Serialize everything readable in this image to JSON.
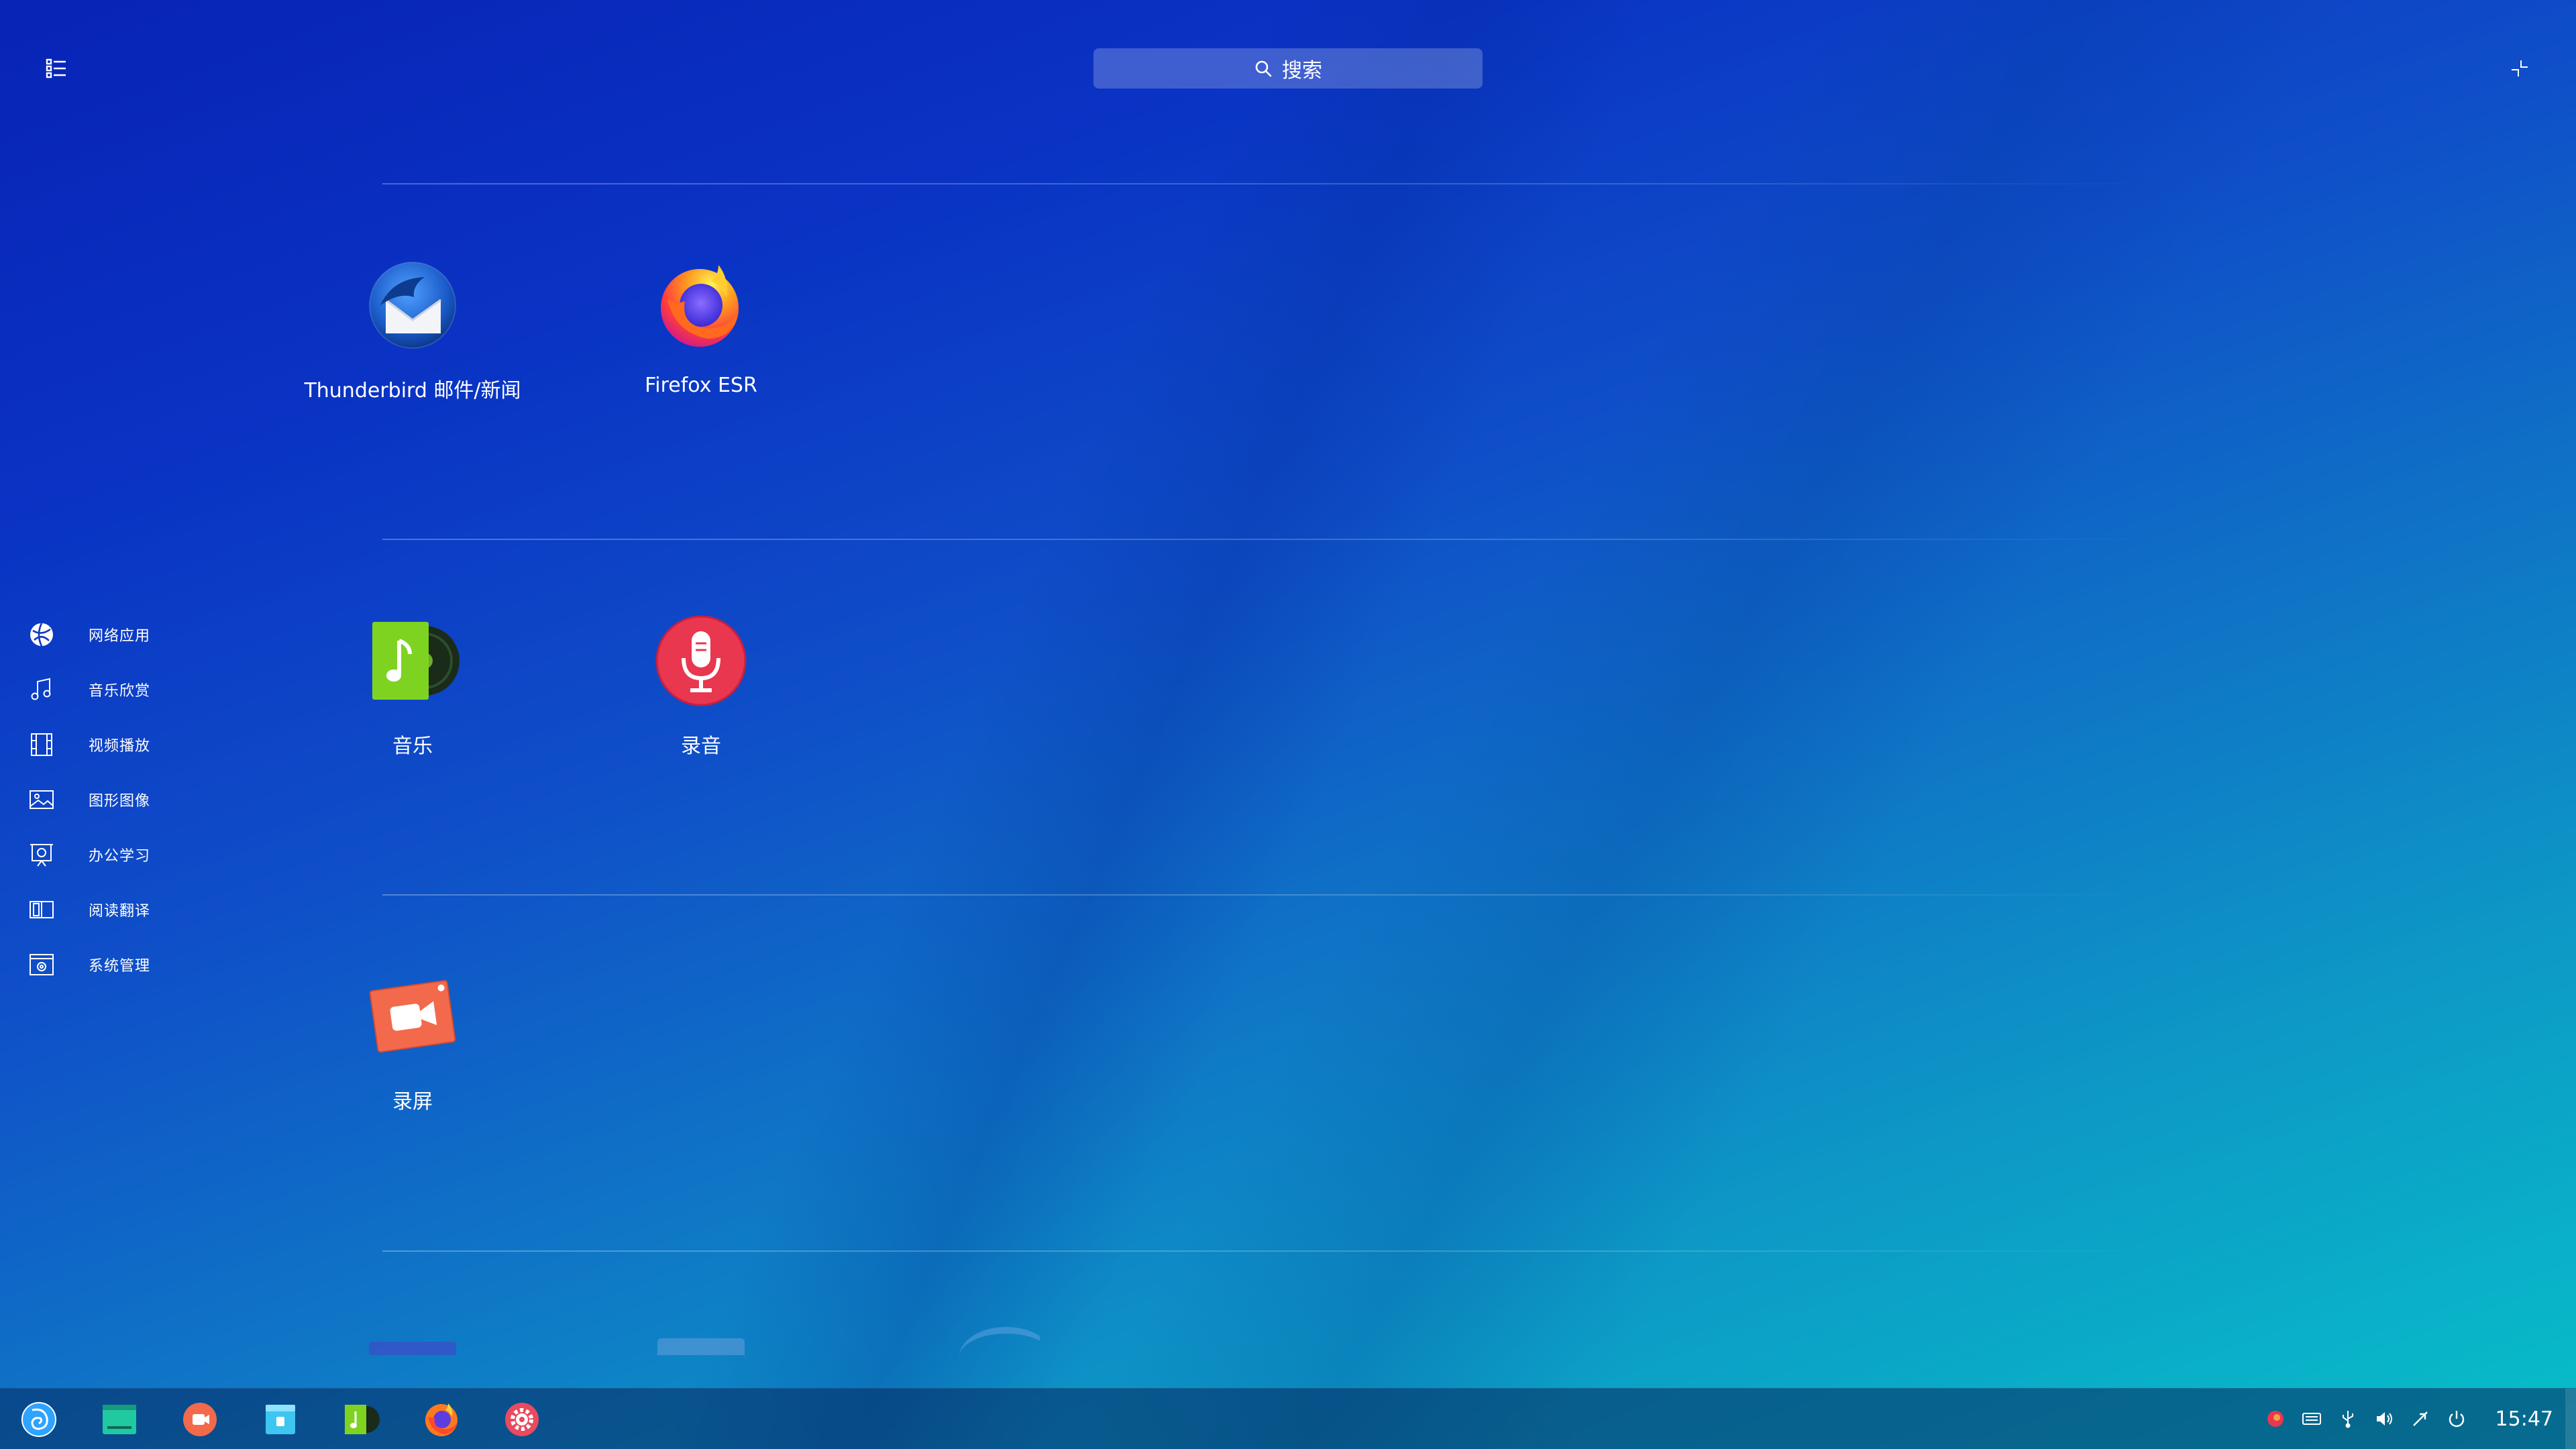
{
  "search": {
    "placeholder": "搜索"
  },
  "sidebar": {
    "categories": [
      {
        "label": "网络应用",
        "icon": "globe-icon"
      },
      {
        "label": "音乐欣赏",
        "icon": "music-note-icon"
      },
      {
        "label": "视频播放",
        "icon": "film-icon"
      },
      {
        "label": "图形图像",
        "icon": "image-icon"
      },
      {
        "label": "办公学习",
        "icon": "presentation-icon"
      },
      {
        "label": "阅读翻译",
        "icon": "book-icon"
      },
      {
        "label": "系统管理",
        "icon": "system-icon"
      }
    ]
  },
  "apps": {
    "thunderbird": "Thunderbird 邮件/新闻",
    "firefox": "Firefox ESR",
    "music": "音乐",
    "recorder": "录音",
    "screen_recorder": "录屏"
  },
  "taskbar": {
    "items": [
      "launcher-icon",
      "terminal-icon",
      "screen-recorder-icon",
      "file-manager-icon",
      "music-icon",
      "firefox-icon",
      "settings-icon"
    ],
    "clock": "15:47"
  },
  "colors": {
    "accent": "#0a33c4",
    "recorder_red": "#e8374f",
    "music_green": "#7ed321",
    "screen_orange": "#f26a4b"
  }
}
